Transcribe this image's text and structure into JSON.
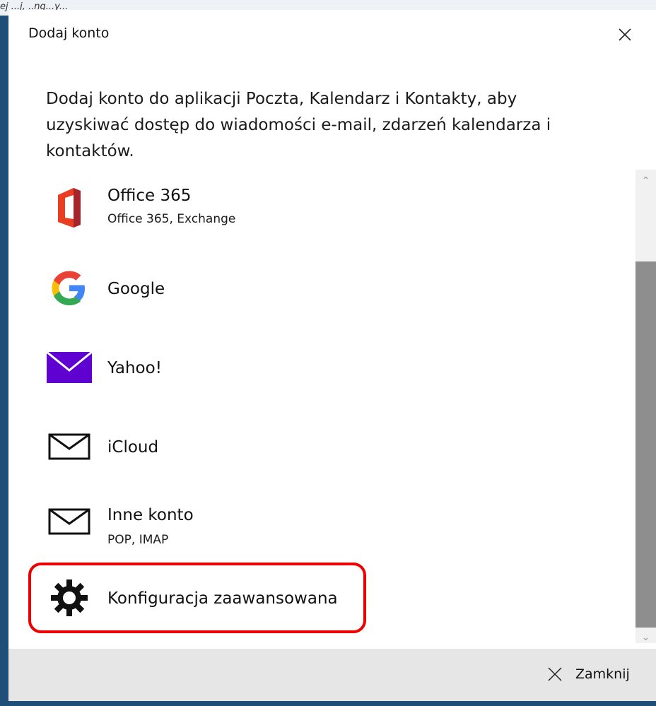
{
  "top_strip": {
    "text": "ej ...j, ..ng...y..."
  },
  "dialog": {
    "title": "Dodaj konto",
    "intro": "Dodaj konto do aplikacji Poczta, Kalendarz i Kontakty, aby uzyskiwać dostęp do wiadomości e-mail, zdarzeń kalendarza i kontaktów.",
    "accounts": [
      {
        "name": "Office 365",
        "sub": "Office 365, Exchange",
        "icon": "office-365-icon"
      },
      {
        "name": "Google",
        "sub": "",
        "icon": "google-icon"
      },
      {
        "name": "Yahoo!",
        "sub": "",
        "icon": "yahoo-mail-icon"
      },
      {
        "name": "iCloud",
        "sub": "",
        "icon": "envelope-icon"
      },
      {
        "name": "Inne konto",
        "sub": "POP, IMAP",
        "icon": "envelope-icon"
      },
      {
        "name": "Konfiguracja zaawansowana",
        "sub": "",
        "icon": "gear-icon"
      }
    ],
    "footer": {
      "close_label": "Zamknij"
    }
  },
  "colors": {
    "highlight": "#ee0000",
    "yahoo": "#5f01d1",
    "google_blue": "#4285f4",
    "google_red": "#ea4335",
    "google_yellow": "#fbbc05",
    "google_green": "#34a853",
    "office": "#d83b01"
  }
}
